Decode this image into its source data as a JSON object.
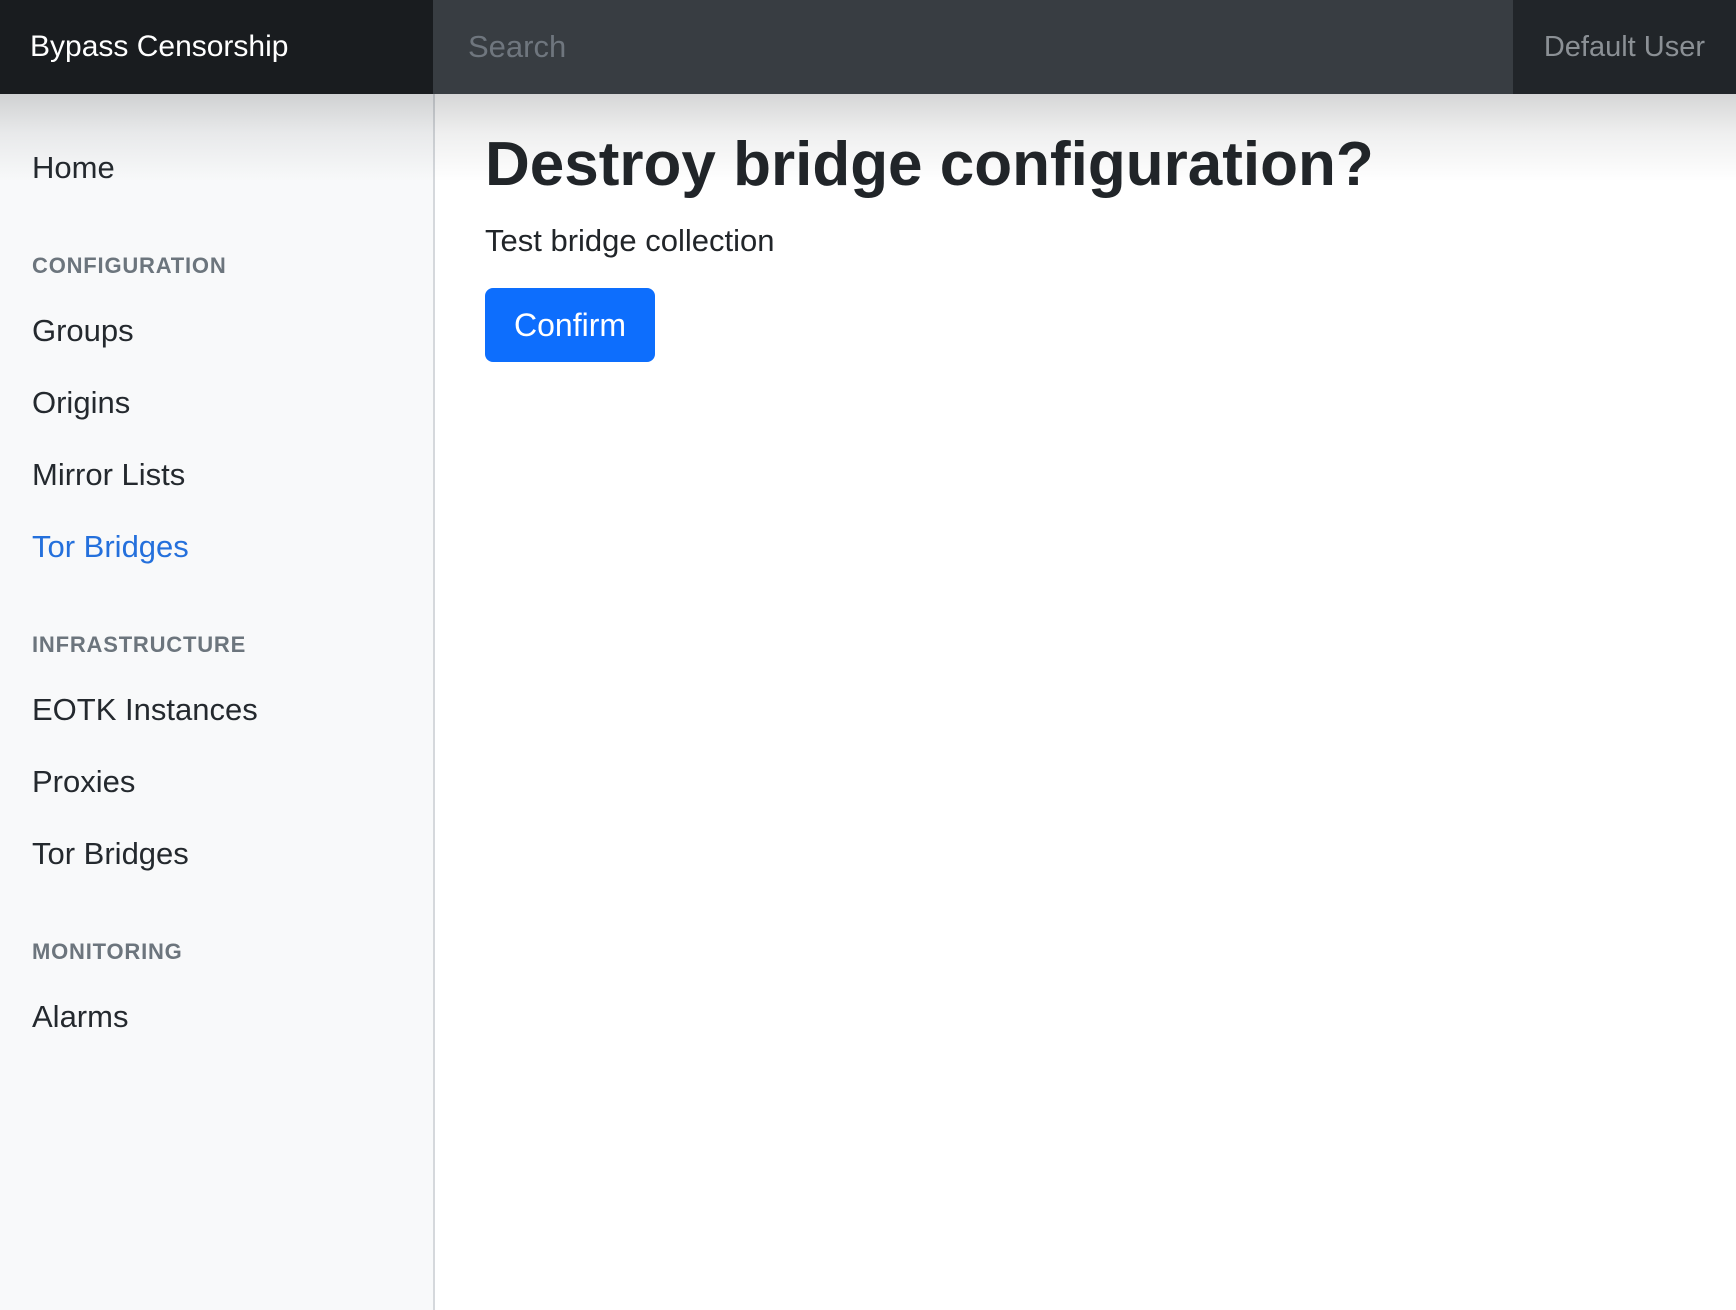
{
  "navbar": {
    "brand": "Bypass Censorship",
    "search": {
      "placeholder": "Search"
    },
    "user_label": "Default User"
  },
  "sidebar": {
    "sections": [
      {
        "heading": null,
        "items": [
          {
            "label": "Home",
            "active": false
          }
        ]
      },
      {
        "heading": "Configuration",
        "items": [
          {
            "label": "Groups",
            "active": false
          },
          {
            "label": "Origins",
            "active": false
          },
          {
            "label": "Mirror Lists",
            "active": false
          },
          {
            "label": "Tor Bridges",
            "active": true
          }
        ]
      },
      {
        "heading": "Infrastructure",
        "items": [
          {
            "label": "EOTK Instances",
            "active": false
          },
          {
            "label": "Proxies",
            "active": false
          },
          {
            "label": "Tor Bridges",
            "active": false
          }
        ]
      },
      {
        "heading": "Monitoring",
        "items": [
          {
            "label": "Alarms",
            "active": false
          }
        ]
      }
    ]
  },
  "main": {
    "title": "Destroy bridge configuration?",
    "subtitle": "Test bridge collection",
    "confirm_label": "Confirm"
  },
  "colors": {
    "navbar_bg": "#212529",
    "brand_bg": "#191c1f",
    "search_bg": "#383d42",
    "sidebar_bg": "#f8f9fa",
    "sidebar_border": "#d5d8dc",
    "active_link": "#2470dc",
    "primary_button": "#0d6efd",
    "heading_text": "#212529",
    "muted_text": "#6c757d"
  }
}
